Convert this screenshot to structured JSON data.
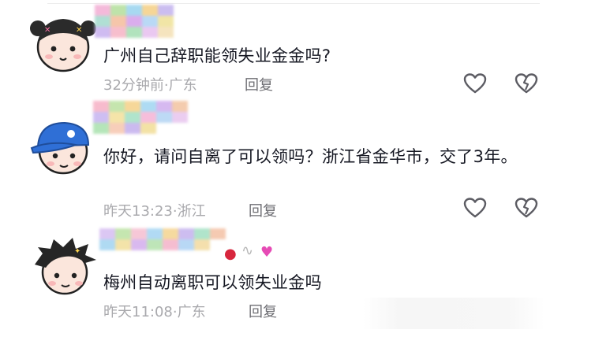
{
  "comments": [
    {
      "text": "广州自己辞职能领失业金金吗?",
      "time": "32分钟前",
      "location": "广东",
      "reply_label": "回复",
      "avatar": "girl-avatar-icon"
    },
    {
      "text": "你好，请问自离了可以领吗？浙江省金华市，交了3年。",
      "time": "昨天13:23",
      "location": "浙江",
      "reply_label": "回复",
      "avatar": "boy-blue-cap-avatar-icon"
    },
    {
      "text": "梅州自动离职可以领失业金吗",
      "time": "昨天11:08",
      "location": "广东",
      "reply_label": "回复",
      "avatar": "boy-black-hair-avatar-icon"
    }
  ],
  "separator": "·",
  "icons": {
    "like": "heart-outline-icon",
    "dislike": "broken-heart-outline-icon"
  },
  "colors": {
    "text": "#161823",
    "meta": "#a9a9ad",
    "reply": "#6e6e73",
    "icon": "#5c5c63"
  }
}
